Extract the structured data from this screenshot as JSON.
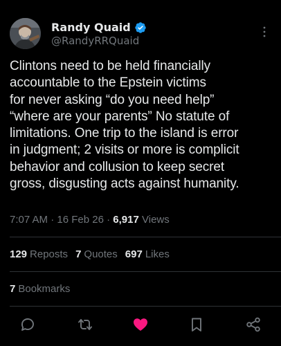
{
  "author": {
    "display_name": "Randy Quaid",
    "handle": "@RandyRRQuaid",
    "verified": true
  },
  "tweet": {
    "text": "Clintons need to be held financially\naccountable to the Epstein victims\nfor never asking “do you need help”\n“where are your parents” No statute of\nlimitations. One trip to the island is error\nin judgment; 2 visits or more is complicit\nbehavior and collusion to keep secret\ngross, disgusting acts against humanity.",
    "time": "7:07 AM",
    "separator": "·",
    "date": "16 Feb 26",
    "views_count": "6,917",
    "views_label": "Views"
  },
  "stats": {
    "reposts_count": "129",
    "reposts_label": "Reposts",
    "quotes_count": "7",
    "quotes_label": "Quotes",
    "likes_count": "697",
    "likes_label": "Likes",
    "bookmarks_count": "7",
    "bookmarks_label": "Bookmarks"
  },
  "actions": [
    {
      "icon": "reply-icon"
    },
    {
      "icon": "repost-icon"
    },
    {
      "icon": "like-icon",
      "active": true,
      "color": "#f91880"
    },
    {
      "icon": "bookmark-icon"
    },
    {
      "icon": "share-icon"
    }
  ],
  "colors": {
    "background": "#000000",
    "text": "#e7e9ea",
    "secondary_text": "#71767b",
    "verified_blue": "#1d9bf0",
    "like_pink": "#f91880",
    "divider": "#2f3336"
  }
}
